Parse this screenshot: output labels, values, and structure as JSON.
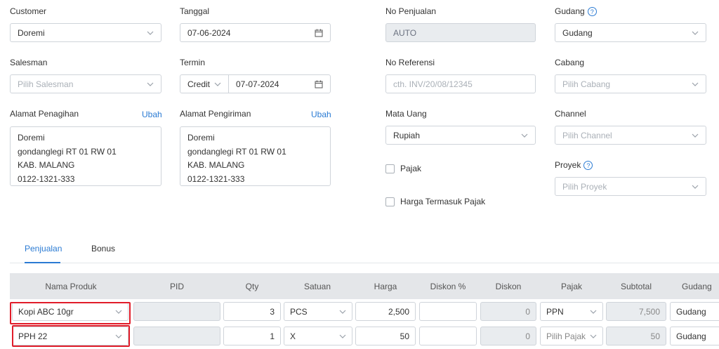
{
  "form": {
    "customer": {
      "label": "Customer",
      "value": "Doremi"
    },
    "tanggal": {
      "label": "Tanggal",
      "value": "07-06-2024"
    },
    "no_penjualan": {
      "label": "No Penjualan",
      "value": "AUTO"
    },
    "gudang": {
      "label": "Gudang",
      "value": "Gudang"
    },
    "salesman": {
      "label": "Salesman",
      "placeholder": "Pilih Salesman"
    },
    "termin": {
      "label": "Termin",
      "type_value": "Credit",
      "date_value": "07-07-2024"
    },
    "no_referensi": {
      "label": "No Referensi",
      "placeholder": "cth. INV/20/08/12345"
    },
    "cabang": {
      "label": "Cabang",
      "placeholder": "Pilih Cabang"
    },
    "alamat_penagihan": {
      "label": "Alamat Penagihan",
      "edit_label": "Ubah",
      "lines": [
        "Doremi",
        "gondanglegi RT 01 RW 01",
        "KAB. MALANG",
        "0122-1321-333"
      ]
    },
    "alamat_pengiriman": {
      "label": "Alamat Pengiriman",
      "edit_label": "Ubah",
      "lines": [
        "Doremi",
        "gondanglegi RT 01 RW 01",
        "KAB. MALANG",
        "0122-1321-333"
      ]
    },
    "mata_uang": {
      "label": "Mata Uang",
      "value": "Rupiah"
    },
    "channel": {
      "label": "Channel",
      "placeholder": "Pilih Channel"
    },
    "pajak_checkbox": {
      "label": "Pajak",
      "checked": false
    },
    "harga_termasuk_pajak": {
      "label": "Harga Termasuk Pajak",
      "checked": false
    },
    "proyek": {
      "label": "Proyek",
      "placeholder": "Pilih Proyek"
    }
  },
  "tabs": [
    {
      "label": "Penjualan",
      "active": true
    },
    {
      "label": "Bonus",
      "active": false
    }
  ],
  "table": {
    "columns": [
      "Nama Produk",
      "PID",
      "Qty",
      "Satuan",
      "Harga",
      "Diskon %",
      "Diskon",
      "Pajak",
      "Subtotal",
      "Gudang"
    ],
    "rows": [
      {
        "produk": "Kopi ABC 10gr",
        "pid": "",
        "qty": "3",
        "satuan": "PCS",
        "harga": "2,500",
        "diskon_pct": "",
        "diskon": "0",
        "pajak": "PPN",
        "pajak_placeholder": false,
        "subtotal": "7,500",
        "gudang": "Gudang"
      },
      {
        "produk": "PPH 22",
        "pid": "",
        "qty": "1",
        "satuan": "X",
        "harga": "50",
        "diskon_pct": "",
        "diskon": "0",
        "pajak": "Pilih Pajak",
        "pajak_placeholder": true,
        "subtotal": "50",
        "gudang": "Gudang"
      }
    ]
  },
  "colors": {
    "accent": "#2b7bd3",
    "highlight": "#e11d2a",
    "header_bg": "#e4e6e9"
  }
}
